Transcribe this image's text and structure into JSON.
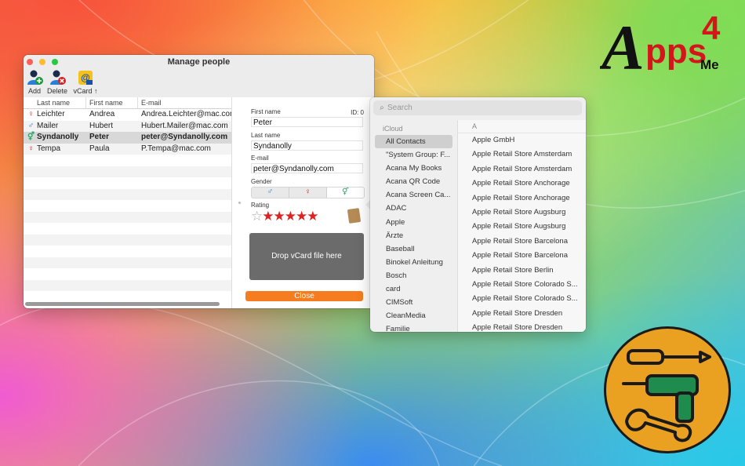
{
  "window": {
    "title": "Manage people",
    "toolbar": {
      "add_label": "Add",
      "delete_label": "Delete",
      "vcard_label": "vCard ↑"
    }
  },
  "table": {
    "columns": [
      "Last name",
      "First name",
      "E-mail"
    ],
    "rows": [
      {
        "gender": "female",
        "last": "Leichter",
        "first": "Andrea",
        "email": "Andrea.Leichter@mac.com"
      },
      {
        "gender": "male",
        "last": "Mailer",
        "first": "Hubert",
        "email": "Hubert.Mailer@mac.com"
      },
      {
        "gender": "group",
        "last": "Syndanolly",
        "first": "Peter",
        "email": "peter@Syndanolly.com"
      },
      {
        "gender": "female",
        "last": "Tempa",
        "first": "Paula",
        "email": "P.Tempa@mac.com"
      }
    ],
    "selected_row": 2
  },
  "detail": {
    "first_name_label": "First name",
    "first_name": "Peter",
    "id_label": "ID: 0",
    "last_name_label": "Last name",
    "last_name": "Syndanolly",
    "email_label": "E-mail",
    "email": "peter@Syndanolly.com",
    "gender_label": "Gender",
    "gender_options": [
      "♂",
      "♀",
      "⚥"
    ],
    "gender_selected": 2,
    "rating_label": "Rating",
    "rating": 5,
    "rating_max": 6,
    "drop_label": "Drop vCard file here",
    "close_label": "Close"
  },
  "contacts": {
    "search_placeholder": "Search",
    "group_header": "iCloud",
    "groups": [
      "All Contacts",
      "\"System Group: F...",
      "Acana My Books",
      "Acana QR Code",
      "Acana Screen Ca...",
      "ADAC",
      "Apple",
      "Ärzte",
      "Baseball",
      "Binokel Anleitung",
      "Bosch",
      "card",
      "CIMSoft",
      "CleanMedia",
      "Familie"
    ],
    "selected_group": 0,
    "section_letter": "A",
    "people": [
      "Apple GmbH",
      "Apple Retail Store Amsterdam",
      "Apple Retail Store Amsterdam",
      "Apple Retail Store Anchorage",
      "Apple Retail Store Anchorage",
      "Apple Retail Store Augsburg",
      "Apple Retail Store Augsburg",
      "Apple Retail Store Barcelona",
      "Apple Retail Store Barcelona",
      "Apple Retail Store Berlin",
      "Apple Retail Store Colorado S...",
      "Apple Retail Store Colorado S...",
      "Apple Retail Store Dresden",
      "Apple Retail Store Dresden"
    ]
  },
  "logo": {
    "text_a": "A",
    "text_pps": "pps",
    "text_4": "4",
    "text_me": "Me"
  },
  "colors": {
    "accent_orange": "#f57c1f",
    "star_red": "#dd2222",
    "badge_orange": "#eaa122"
  }
}
